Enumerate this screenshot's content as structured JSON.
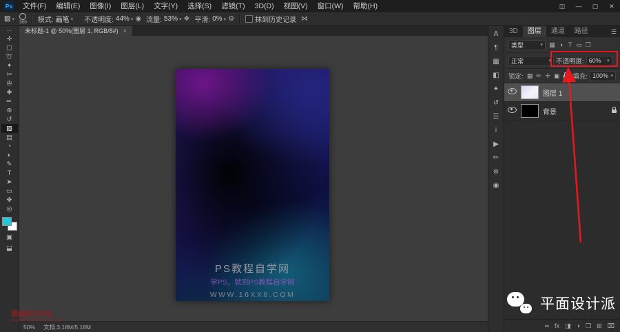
{
  "menubar": {
    "logo": "Ps",
    "items": [
      "文件(F)",
      "编辑(E)",
      "图像(I)",
      "图层(L)",
      "文字(Y)",
      "选择(S)",
      "滤镜(T)",
      "3D(D)",
      "视图(V)",
      "窗口(W)",
      "帮助(H)"
    ],
    "window_controls": [
      {
        "name": "workspace-switcher-icon",
        "glyph": "◫"
      },
      {
        "name": "minimize-button",
        "glyph": "—"
      },
      {
        "name": "maximize-button",
        "glyph": "▢"
      },
      {
        "name": "close-button",
        "glyph": "✕"
      }
    ]
  },
  "options": {
    "tool_icon": "▨",
    "brush_size": "300",
    "mode_label": "模式:",
    "mode_value": "画笔",
    "opacity_label": "不透明度:",
    "opacity_value": "44%",
    "pressure_icon": "◉",
    "flow_label": "流量:",
    "flow_value": "53%",
    "airbrush_icon": "❖",
    "smoothing_label": "平滑:",
    "smoothing_value": "0%",
    "gear_icon": "⚙",
    "erase_history_label": "抹到历史记录",
    "symmetry_icon": "⋈"
  },
  "toolbar": {
    "ellipsis": "⋯",
    "tools": [
      {
        "name": "move-tool",
        "glyph": "✛"
      },
      {
        "name": "marquee-tool",
        "glyph": "▢"
      },
      {
        "name": "lasso-tool",
        "glyph": "➰"
      },
      {
        "name": "quick-selection-tool",
        "glyph": "✦"
      },
      {
        "name": "crop-tool",
        "glyph": "✂"
      },
      {
        "name": "eyedropper-tool",
        "glyph": "✇"
      },
      {
        "name": "healing-brush-tool",
        "glyph": "✚"
      },
      {
        "name": "brush-tool",
        "glyph": "✏"
      },
      {
        "name": "clone-stamp-tool",
        "glyph": "⊛"
      },
      {
        "name": "history-brush-tool",
        "glyph": "↺"
      },
      {
        "name": "eraser-tool",
        "glyph": "▨",
        "active": true
      },
      {
        "name": "gradient-tool",
        "glyph": "▤"
      },
      {
        "name": "blur-tool",
        "glyph": "◔"
      },
      {
        "name": "dodge-tool",
        "glyph": "◐"
      },
      {
        "name": "pen-tool",
        "glyph": "✎"
      },
      {
        "name": "type-tool",
        "glyph": "T"
      },
      {
        "name": "path-selection-tool",
        "glyph": "➤"
      },
      {
        "name": "shape-tool",
        "glyph": "▭"
      },
      {
        "name": "hand-tool",
        "glyph": "✥"
      },
      {
        "name": "zoom-tool",
        "glyph": "◎"
      }
    ],
    "foreground_color": "#29c5d6",
    "background_color": "#ffffff",
    "quick_mask_icon": "▣",
    "screen_mode_icon": "⬓"
  },
  "doc_tab": {
    "title": "未标题-1 @ 50%(图层 1, RGB/8#)",
    "close_glyph": "×"
  },
  "canvas_text": {
    "line1": "PS教程自学网",
    "line2": "学PS，就到PS教程自学网",
    "line3": "WWW.16XX8.COM"
  },
  "statusbar": {
    "zoom": "50%",
    "doc_info": "文档:3.18M/5.18M"
  },
  "watermark": {
    "site_name": "思缘设计论坛",
    "site_url": "WWW.MISSYUAN.COM"
  },
  "rightstrip": {
    "icons": [
      {
        "name": "character-panel-icon",
        "glyph": "A"
      },
      {
        "name": "paragraph-panel-icon",
        "glyph": "¶"
      },
      {
        "name": "swatches-panel-icon",
        "glyph": "▦"
      },
      {
        "name": "adjustments-panel-icon",
        "glyph": "◧"
      },
      {
        "name": "styles-panel-icon",
        "glyph": "✦"
      },
      {
        "name": "history-panel-icon",
        "glyph": "↺"
      },
      {
        "name": "properties-panel-icon",
        "glyph": "☰"
      },
      {
        "name": "info-panel-icon",
        "glyph": "i"
      },
      {
        "name": "actions-panel-icon",
        "glyph": "▶"
      },
      {
        "name": "brush-settings-panel-icon",
        "glyph": "✏"
      },
      {
        "name": "clone-source-panel-icon",
        "glyph": "⊛"
      },
      {
        "name": "lights-panel-icon",
        "glyph": "◉"
      }
    ]
  },
  "layers_panel": {
    "tabs": [
      {
        "label": "3D"
      },
      {
        "label": "图层",
        "active": true
      },
      {
        "label": "通道"
      },
      {
        "label": "路径"
      }
    ],
    "panel_menu_icon": "☰",
    "kind_label": "类型",
    "filter_icons": [
      {
        "name": "filter-pixel-layers-icon",
        "glyph": "▦"
      },
      {
        "name": "filter-adjustment-layers-icon",
        "glyph": "◑"
      },
      {
        "name": "filter-type-layers-icon",
        "glyph": "T"
      },
      {
        "name": "filter-shape-layers-icon",
        "glyph": "▭"
      },
      {
        "name": "filter-smart-objects-icon",
        "glyph": "❒"
      }
    ],
    "blend_mode": "正常",
    "opacity_label": "不透明度:",
    "opacity_value": "60%",
    "lock_label": "锁定:",
    "lock_icons": [
      {
        "name": "lock-transparent-pixels-icon",
        "glyph": "▦"
      },
      {
        "name": "lock-image-pixels-icon",
        "glyph": "✏"
      },
      {
        "name": "lock-position-icon",
        "glyph": "✛"
      },
      {
        "name": "lock-artboard-icon",
        "glyph": "▣"
      },
      {
        "name": "lock-all-icon",
        "glyph": ""
      }
    ],
    "fill_label": "填充:",
    "fill_value": "100%",
    "layers": [
      {
        "name": "图层 1",
        "selected": true,
        "thumb": "light",
        "locked": false
      },
      {
        "name": "背景",
        "selected": false,
        "thumb": "black",
        "locked": true
      }
    ],
    "bottom_icons": [
      {
        "name": "link-layers-icon",
        "glyph": "∞"
      },
      {
        "name": "layer-style-icon",
        "glyph": "fx"
      },
      {
        "name": "layer-mask-icon",
        "glyph": "◨"
      },
      {
        "name": "adjustment-layer-icon",
        "glyph": "◑"
      },
      {
        "name": "new-group-icon",
        "glyph": "❒"
      },
      {
        "name": "new-layer-icon",
        "glyph": "⊞"
      },
      {
        "name": "delete-layer-icon",
        "glyph": "⌧"
      }
    ]
  },
  "wechat": {
    "account_name": "平面设计派"
  },
  "annotation": {
    "color": "#e8191e"
  }
}
